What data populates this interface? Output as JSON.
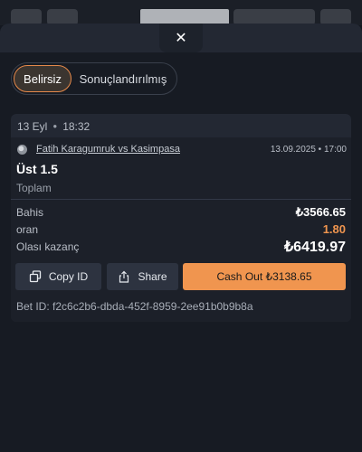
{
  "sheet": {
    "close_icon": "close-icon",
    "close_glyph": "✕"
  },
  "filters": {
    "tabs": [
      {
        "label": "Belirsiz",
        "active": true
      },
      {
        "label": "Sonuçlandırılmış",
        "active": false
      }
    ]
  },
  "bet": {
    "date": "13 Eyl",
    "time": "18:32",
    "match": "Fatih Karagumruk vs Kasimpasa",
    "match_datetime": "13.09.2025 • 17:00",
    "market": "Üst 1.5",
    "market_type": "Toplam",
    "stake_label": "Bahis",
    "stake_value": "₺3566.65",
    "odds_label": "oran",
    "odds_value": "1.80",
    "potential_label": "Olası kazanç",
    "potential_value": "₺6419.97",
    "copy_label": "Copy ID",
    "share_label": "Share",
    "cashout_label": "Cash Out ₺3138.65",
    "bet_id": "Bet ID: f2c6c2b6-dbda-452f-8959-2ee91b0b9b8a"
  },
  "colors": {
    "accent": "#f0954f",
    "background": "#141820",
    "card": "#232833"
  }
}
